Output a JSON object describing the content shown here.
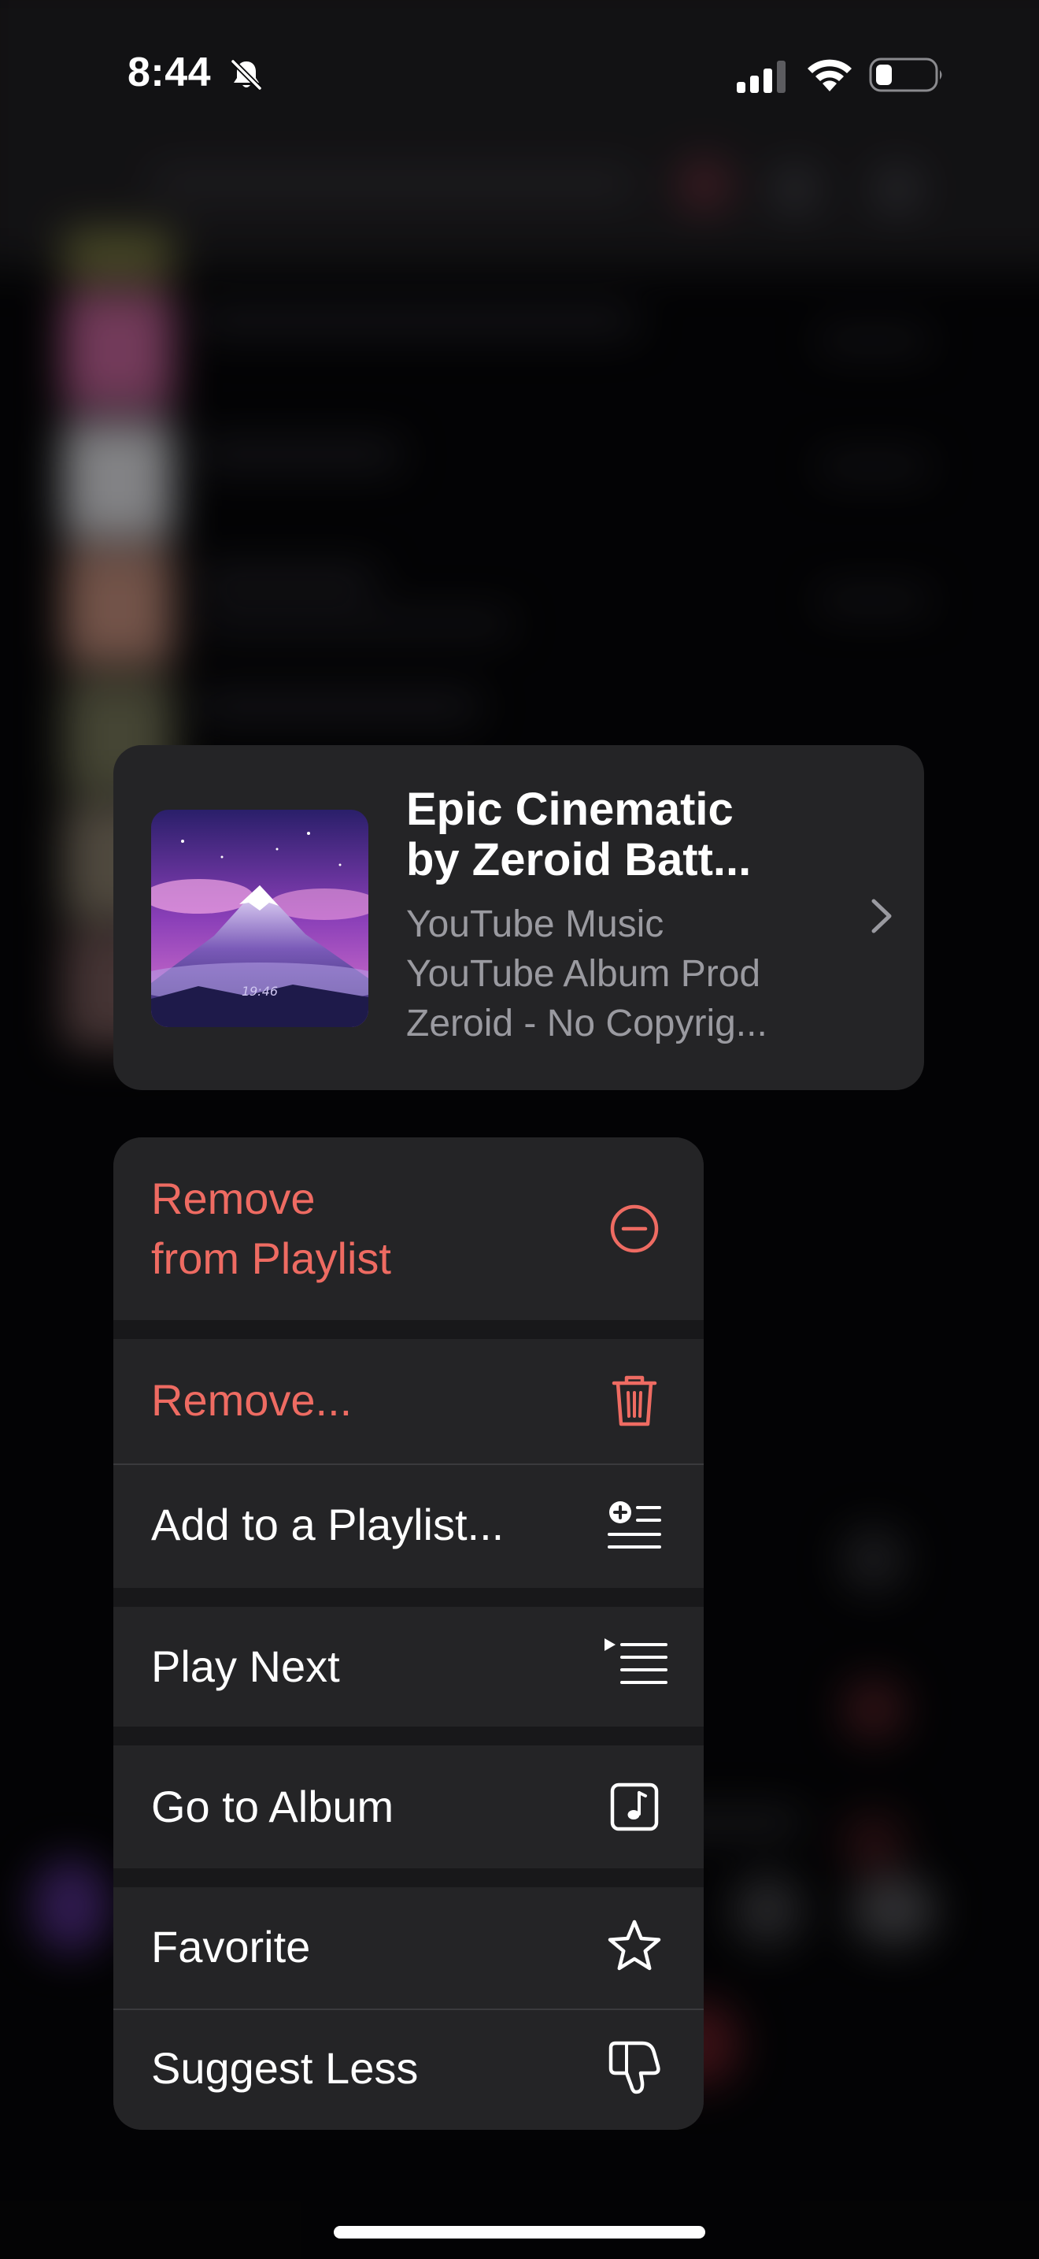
{
  "status_bar": {
    "time": "8:44",
    "icons": [
      "bell-slash-icon",
      "cellular-signal-icon",
      "wifi-icon",
      "battery-icon"
    ]
  },
  "preview": {
    "title_line1": "Epic Cinematic",
    "title_line2": "by Zeroid   Batt...",
    "subtitle_lines": [
      "YouTube Music",
      "YouTube Album Prod",
      "Zeroid - No Copyrig..."
    ],
    "art_text": "19:46",
    "chevron_icon": "chevron-right-icon"
  },
  "menu": {
    "items": [
      {
        "label_line1": "Remove",
        "label_line2": "from Playlist",
        "icon": "minus-circle-icon",
        "destructive": true
      },
      {
        "label": "Remove...",
        "icon": "trash-icon",
        "destructive": true
      },
      {
        "label": "Add to a Playlist...",
        "icon": "add-to-playlist-icon",
        "destructive": false
      },
      {
        "label": "Play Next",
        "icon": "play-next-icon",
        "destructive": false
      },
      {
        "label": "Go to Album",
        "icon": "music-note-square-icon",
        "destructive": false
      },
      {
        "label": "Favorite",
        "icon": "star-icon",
        "destructive": false
      },
      {
        "label": "Suggest Less",
        "icon": "thumbs-down-icon",
        "destructive": false
      }
    ]
  },
  "colors": {
    "destructive": "#ee6b62",
    "menu_bg": "#242426",
    "card_bg": "#242426",
    "secondary_text": "#9a9aa0"
  }
}
